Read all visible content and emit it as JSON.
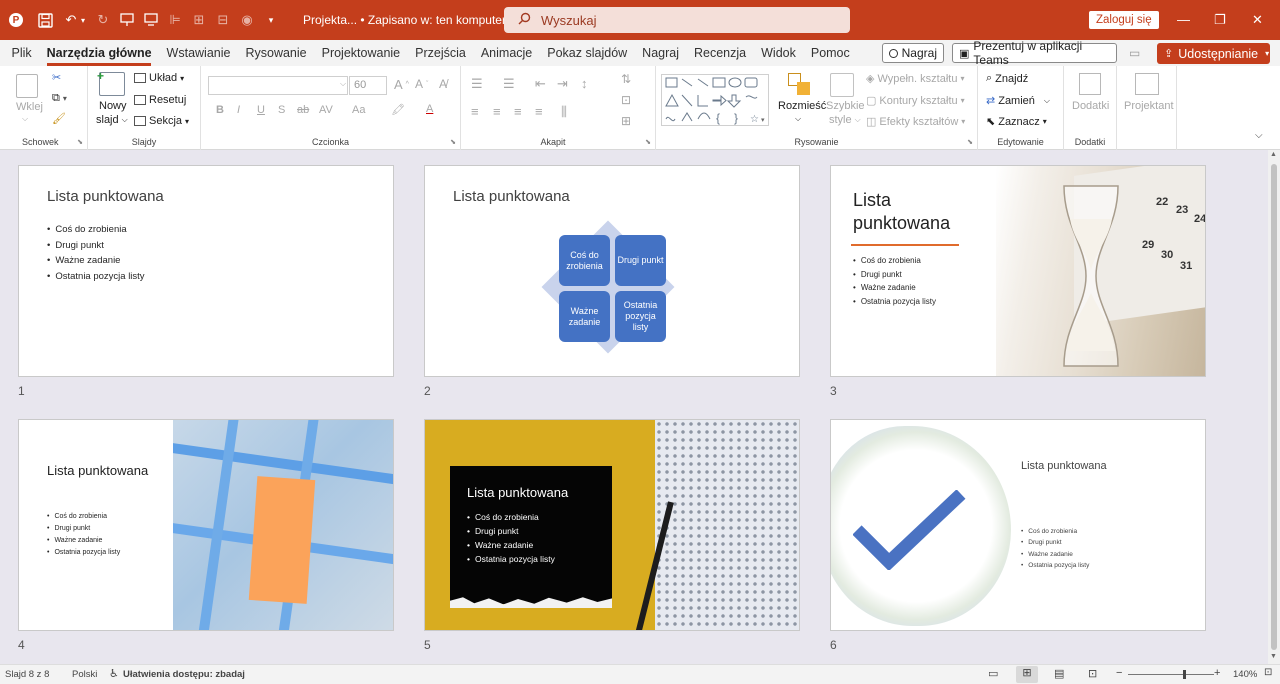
{
  "titlebar": {
    "doc_title": "Projekta... • Zapisano w: ten komputer",
    "search_placeholder": "Wyszukaj",
    "signin_label": "Zaloguj się"
  },
  "menu": {
    "tabs": [
      "Plik",
      "Narzędzia główne",
      "Wstawianie",
      "Rysowanie",
      "Projektowanie",
      "Przejścia",
      "Animacje",
      "Pokaz slajdów",
      "Nagraj",
      "Recenzja",
      "Widok",
      "Pomoc"
    ],
    "record_label": "Nagraj",
    "teams_label": "Prezentuj w aplikacji Teams",
    "share_label": "Udostępnianie"
  },
  "ribbon": {
    "paste": "Wklej",
    "schowek": "Schowek",
    "new_slide_1": "Nowy",
    "new_slide_2": "slajd",
    "layout": "Układ",
    "reset": "Resetuj",
    "section": "Sekcja",
    "slajdy": "Slajdy",
    "font_size": "60",
    "czcionka": "Czcionka",
    "akapit": "Akapit",
    "arrange": "Rozmieść",
    "quick_styles_1": "Szybkie",
    "quick_styles_2": "style",
    "shape_fill": "Wypełn. kształtu",
    "shape_outline": "Kontury kształtu",
    "shape_effects": "Efekty kształtów",
    "rysowanie": "Rysowanie",
    "find": "Znajdź",
    "replace": "Zamień",
    "select": "Zaznacz",
    "edytowanie": "Edytowanie",
    "addins": "Dodatki",
    "dodatki": "Dodatki",
    "designer": "Projektant"
  },
  "slides": {
    "title": "Lista punktowana",
    "title_line1": "Lista",
    "title_line2": "punktowana",
    "bullets": [
      "Coś do zrobienia",
      "Drugi punkt",
      "Ważne zadanie",
      "Ostatnia pozycja listy"
    ],
    "smartart": [
      "Coś do zrobienia",
      "Drugi punkt",
      "Ważne zadanie",
      "Ostatnia pozycja listy"
    ],
    "numbers": [
      "1",
      "2",
      "3",
      "4",
      "5",
      "6"
    ],
    "calendar_numbers": [
      "22",
      "23",
      "24",
      "29",
      "30",
      "31"
    ]
  },
  "colors": {
    "accent": "#c43e1c",
    "smartart_blue": "#4472c4",
    "diamond_bg": "#c9d3ec",
    "checkmark": "#4a72c2",
    "orange_underline": "#e06b2c",
    "sticky_orange": "#fba35a",
    "yellow": "#d8ac20"
  },
  "status": {
    "slide_info": "Slajd 8 z 8",
    "language": "Polski",
    "accessibility": "Ułatwienia dostępu: zbadaj",
    "zoom": "140%"
  }
}
